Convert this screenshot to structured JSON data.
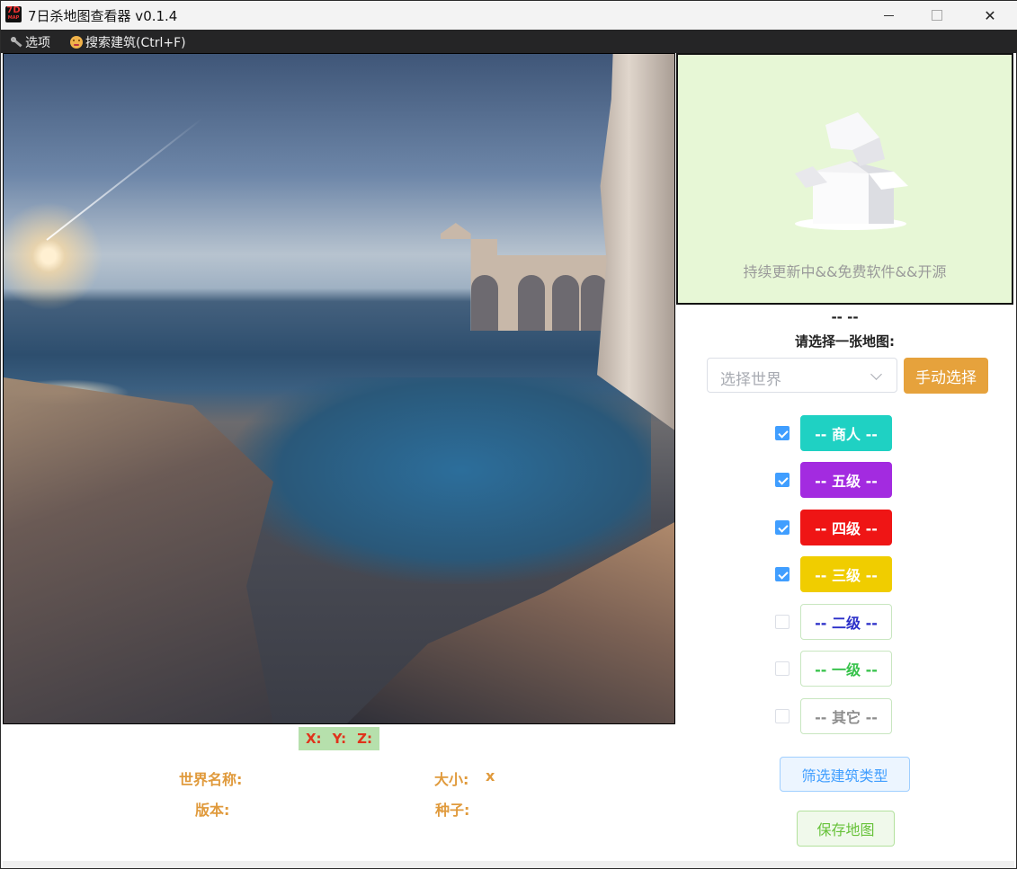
{
  "window": {
    "title": "7日杀地图查看器 v0.1.4",
    "app_icon_text": "7D",
    "app_icon_sub": "MAP",
    "close_glyph": "✕"
  },
  "menu": {
    "options_label": "选项",
    "search_label": "搜索建筑(Ctrl+F)"
  },
  "coords": {
    "x_label": "X:",
    "y_label": "Y:",
    "z_label": "Z:"
  },
  "info": {
    "world_name_label": "世界名称:",
    "size_label": "大小:",
    "size_value": "x",
    "version_label": "版本:",
    "seed_label": "种子:"
  },
  "preview": {
    "caption": "持续更新中&&免费软件&&开源"
  },
  "panel": {
    "dash": "-- --",
    "prompt": "请选择一张地图:",
    "world_select_placeholder": "选择世界",
    "manual_select_label": "手动选择"
  },
  "categories": [
    {
      "label": "-- 商人 --",
      "checked": true,
      "color": "#1fd1c3"
    },
    {
      "label": "-- 五级 --",
      "checked": true,
      "color": "#a32be0"
    },
    {
      "label": "-- 四级 --",
      "checked": true,
      "color": "#ef1515"
    },
    {
      "label": "-- 三级 --",
      "checked": true,
      "color": "#f0cd00"
    },
    {
      "label": "-- 二级 --",
      "checked": false,
      "color": "#2b2fc9"
    },
    {
      "label": "-- 一级 --",
      "checked": false,
      "color": "#36c24a"
    },
    {
      "label": "-- 其它 --",
      "checked": false,
      "color": "#8c8c8c"
    }
  ],
  "actions": {
    "filter_label": "筛选建筑类型",
    "save_label": "保存地图"
  }
}
